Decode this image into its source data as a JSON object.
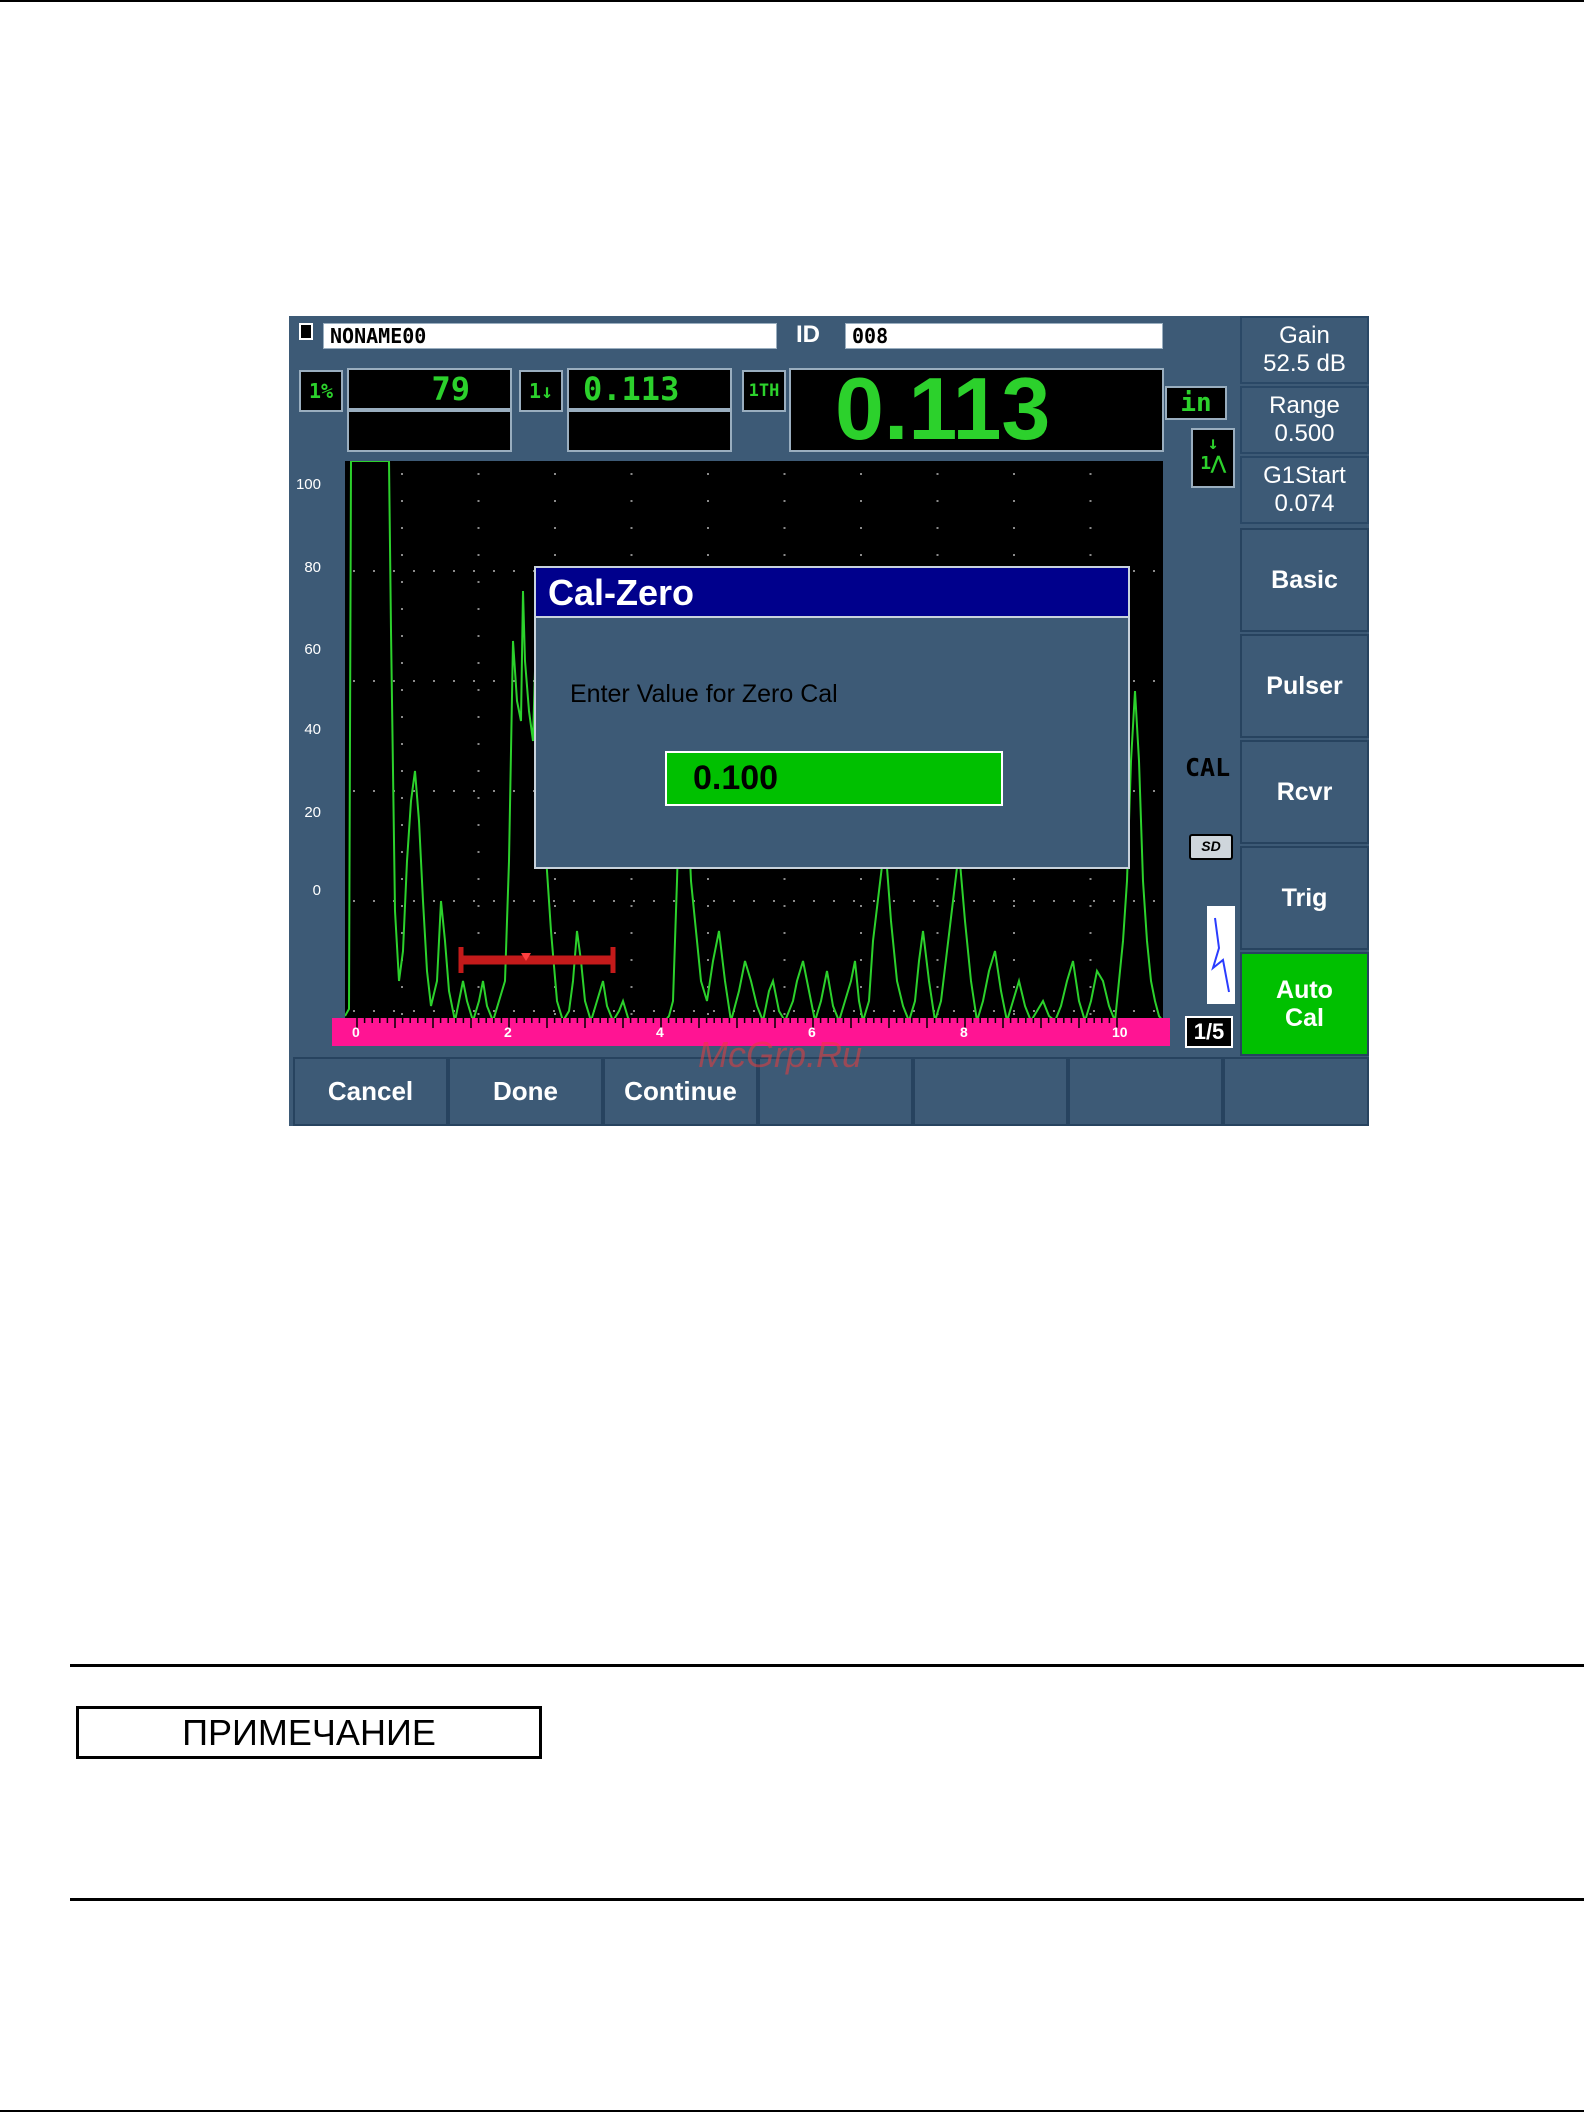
{
  "screen": {
    "file_name": "NONAME00",
    "id_label": "ID",
    "id_value": "008",
    "readings": {
      "r1_icon": "1%",
      "r1_value": "79",
      "r2_icon": "1↓",
      "r2_value": "0.113",
      "r3_icon": "1TH",
      "main_value": "0.113",
      "unit": "in"
    },
    "side_params": [
      {
        "label": "Gain",
        "value": "52.5 dB"
      },
      {
        "label": "Range",
        "value": "0.500"
      },
      {
        "label": "G1Start",
        "value": "0.074"
      }
    ],
    "side_menu": [
      "Basic",
      "Pulser",
      "Rcvr",
      "Trig",
      "Auto Cal"
    ],
    "active_menu": "Auto Cal",
    "status": {
      "cal": "CAL",
      "sd": "SD",
      "page": "1/5"
    },
    "y_ticks": [
      "100",
      "80",
      "60",
      "40",
      "20",
      "0"
    ],
    "x_ticks": [
      "0",
      "2",
      "4",
      "6",
      "8",
      "10"
    ],
    "bottom_buttons": [
      "Cancel",
      "Done",
      "Continue",
      "",
      "",
      "",
      ""
    ],
    "dialog": {
      "title": "Cal-Zero",
      "prompt": "Enter Value for Zero Cal",
      "value": "0.100"
    },
    "colors": {
      "waveform": "#2cd12c",
      "gate": "#c41a1a",
      "ruler": "#ff1493",
      "dialog_title": "#00008c",
      "active": "#00c000"
    }
  },
  "note": {
    "label": "ПРИМЕЧАНИЕ"
  },
  "watermark": "McGrp.Ru"
}
